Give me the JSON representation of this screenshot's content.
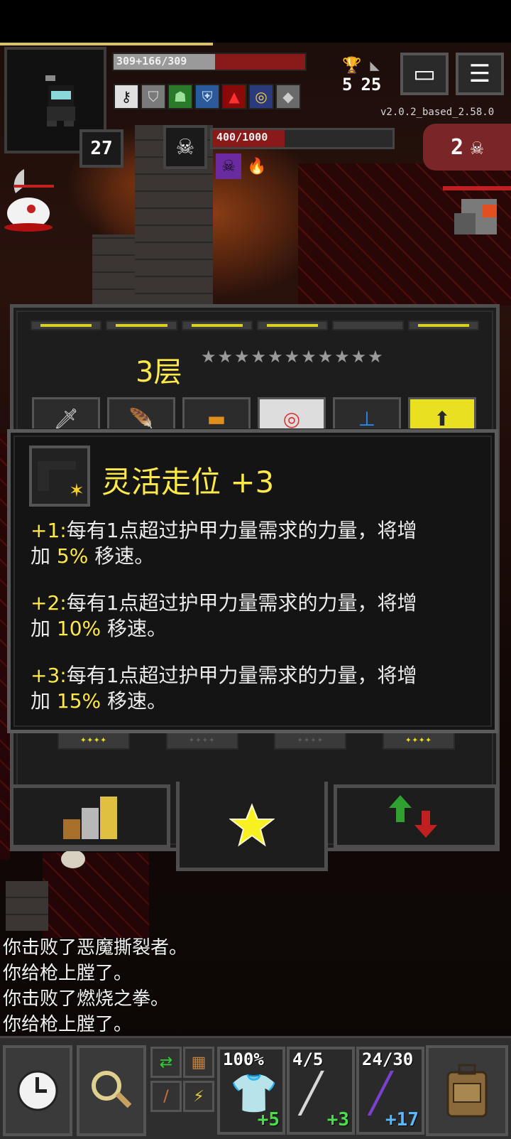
{
  "hud": {
    "hp_text": "309+166/309",
    "hp_fraction": 1.0,
    "shield_fraction": 0.53,
    "level": "27",
    "gold": "5",
    "depth": "25",
    "version": "v2.0.2_based_2.58.0",
    "boss_hp_text": "400/1000",
    "boss_hp_fraction": 0.4,
    "danger_count": "2",
    "buff_icons": [
      "key-icon",
      "shield-icon",
      "hood-icon",
      "armor-icon",
      "rage-icon",
      "ring-icon",
      "stone-icon"
    ],
    "boss_debuff_icons": [
      "skull-debuff-icon",
      "fire-debuff-icon"
    ]
  },
  "talents": {
    "tier_label": "3层",
    "tier_stars": "★★★★★★★★★★★",
    "row_icons": [
      "knife-icon",
      "feather-icon",
      "rifle-icon",
      "target-icon",
      "radar-icon",
      "upgrade-icon"
    ],
    "bottom_ticks": [
      "✦✦✦✦",
      "✦✦✦✦",
      "✦✦✦✦",
      "✦✦✦✦"
    ],
    "bottom_ticks_lit": [
      true,
      false,
      false,
      true
    ]
  },
  "tooltip": {
    "title": "灵活走位 +3",
    "lines": [
      {
        "prefix": "+1:",
        "text_a": "每有1点超过护甲力量需求的力量，将增",
        "text_b_pre": "加 ",
        "value": "5%",
        "text_b_post": " 移速。"
      },
      {
        "prefix": "+2:",
        "text_a": "每有1点超过护甲力量需求的力量，将增",
        "text_b_pre": "加 ",
        "value": "10%",
        "text_b_post": " 移速。"
      },
      {
        "prefix": "+3:",
        "text_a": "每有1点超过护甲力量需求的力量，将增",
        "text_b_pre": "加 ",
        "value": "15%",
        "text_b_post": " 移速。"
      }
    ]
  },
  "log": [
    "你击败了恶魔撕裂者。",
    "你给枪上膛了。",
    "你击败了燃烧之拳。",
    "你给枪上膛了。"
  ],
  "toolbar": {
    "armor_top": "100%",
    "armor_bonus": "+5",
    "weapon_top": "4/5",
    "weapon_bonus": "+3",
    "wand_top": "24/30",
    "wand_bonus": "+17"
  },
  "colors": {
    "accent_yellow": "#ffe84a",
    "hp_red": "#8a1a1a",
    "bonus_green": "#48e048",
    "bonus_blue": "#5ab8ff"
  }
}
